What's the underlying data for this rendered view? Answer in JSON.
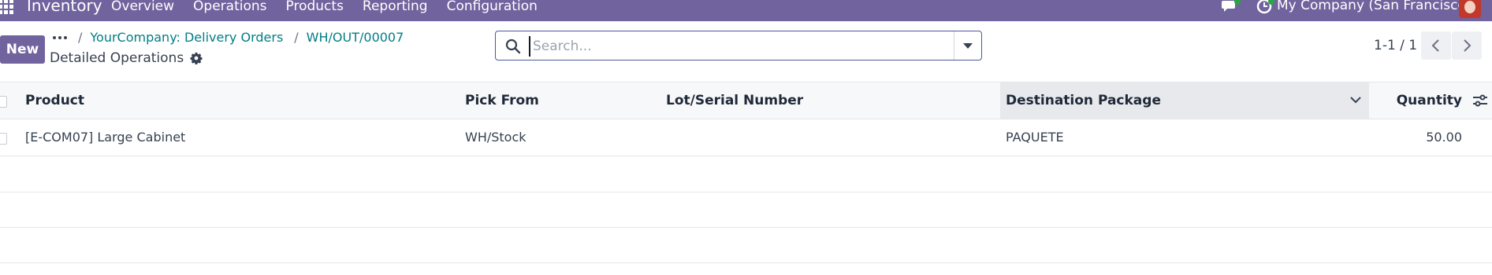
{
  "navbar": {
    "app_name": "Inventory",
    "menu": [
      "Overview",
      "Operations",
      "Products",
      "Reporting",
      "Configuration"
    ],
    "company": "My Company (San Francisco)",
    "color": "#71639e"
  },
  "control_panel": {
    "new_label": "New",
    "breadcrumb": [
      "YourCompany: Delivery Orders",
      "WH/OUT/00007"
    ],
    "separator": "/",
    "subtitle": "Detailed Operations",
    "search_placeholder": "Search...",
    "pager": "1-1 / 1"
  },
  "table": {
    "columns": [
      "Product",
      "Pick From",
      "Lot/Serial Number",
      "Destination Package",
      "Quantity"
    ],
    "rows": [
      {
        "product": "[E-COM07] Large Cabinet",
        "pick_from": "WH/Stock",
        "lot": "",
        "package": "PAQUETE",
        "quantity": "50.00"
      }
    ]
  },
  "icons": {
    "apps": "apps-grid-icon",
    "chat": "chat-icon",
    "activity": "activity-clock-icon",
    "breadcrumb_menu": "ellipsis-icon",
    "settings": "gear-icon",
    "search": "search-icon",
    "search_toggle": "caret-down-icon",
    "pager_prev": "chevron-left-icon",
    "pager_next": "chevron-right-icon",
    "column_sort": "chevron-down-icon",
    "optional_columns": "sliders-icon"
  }
}
